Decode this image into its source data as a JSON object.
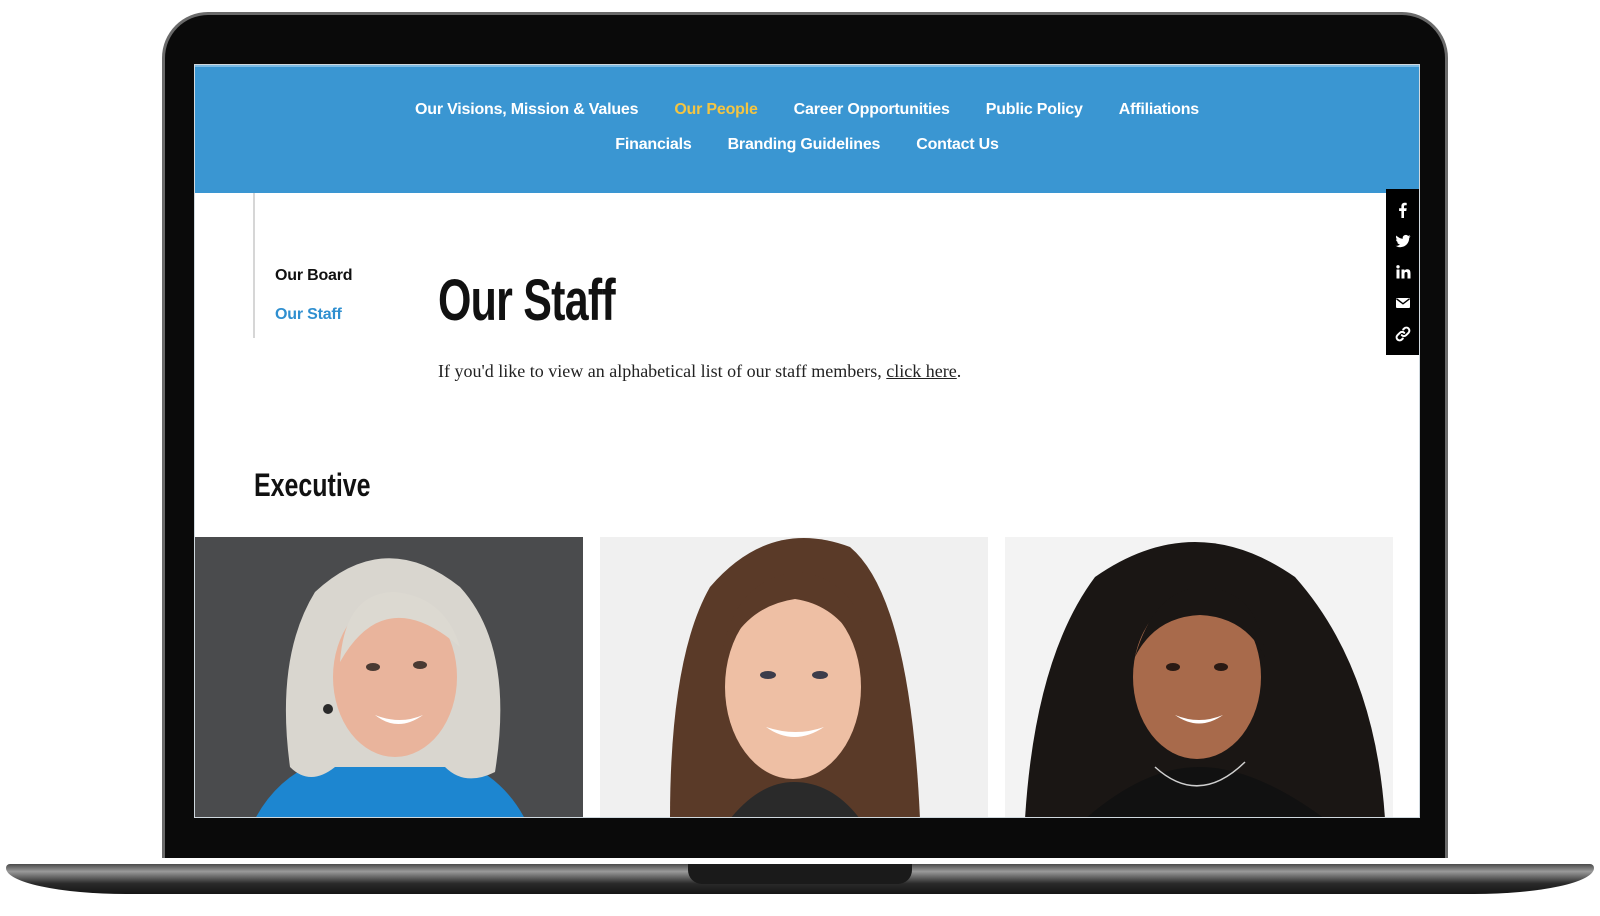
{
  "nav": {
    "row1": [
      {
        "label": "Our Visions, Mission & Values",
        "active": false
      },
      {
        "label": "Our People",
        "active": true
      },
      {
        "label": "Career Opportunities",
        "active": false
      },
      {
        "label": "Public Policy",
        "active": false
      },
      {
        "label": "Affiliations",
        "active": false
      }
    ],
    "row2": [
      {
        "label": "Financials",
        "active": false
      },
      {
        "label": "Branding Guidelines",
        "active": false
      },
      {
        "label": "Contact Us",
        "active": false
      }
    ],
    "active_color": "#f4c542",
    "background_color": "#3a96d2"
  },
  "sidebar": {
    "items": [
      {
        "label": "Our Board",
        "selected": false
      },
      {
        "label": "Our Staff",
        "selected": true
      }
    ],
    "selected_color": "#2f8fd0"
  },
  "main": {
    "title": "Our Staff",
    "intro_text": "If you'd like to view an alphabetical list of our staff members, ",
    "intro_link": "click here",
    "intro_end": ".",
    "section_heading": "Executive"
  },
  "social": [
    "facebook-icon",
    "twitter-icon",
    "linkedin-icon",
    "email-icon",
    "link-icon"
  ],
  "staff_photos": [
    {
      "description_icon": "portrait-photo",
      "background": "#4a4b4d"
    },
    {
      "description_icon": "portrait-photo",
      "background": "#f0f0f0"
    },
    {
      "description_icon": "portrait-photo",
      "background": "#f3f3f3"
    }
  ]
}
